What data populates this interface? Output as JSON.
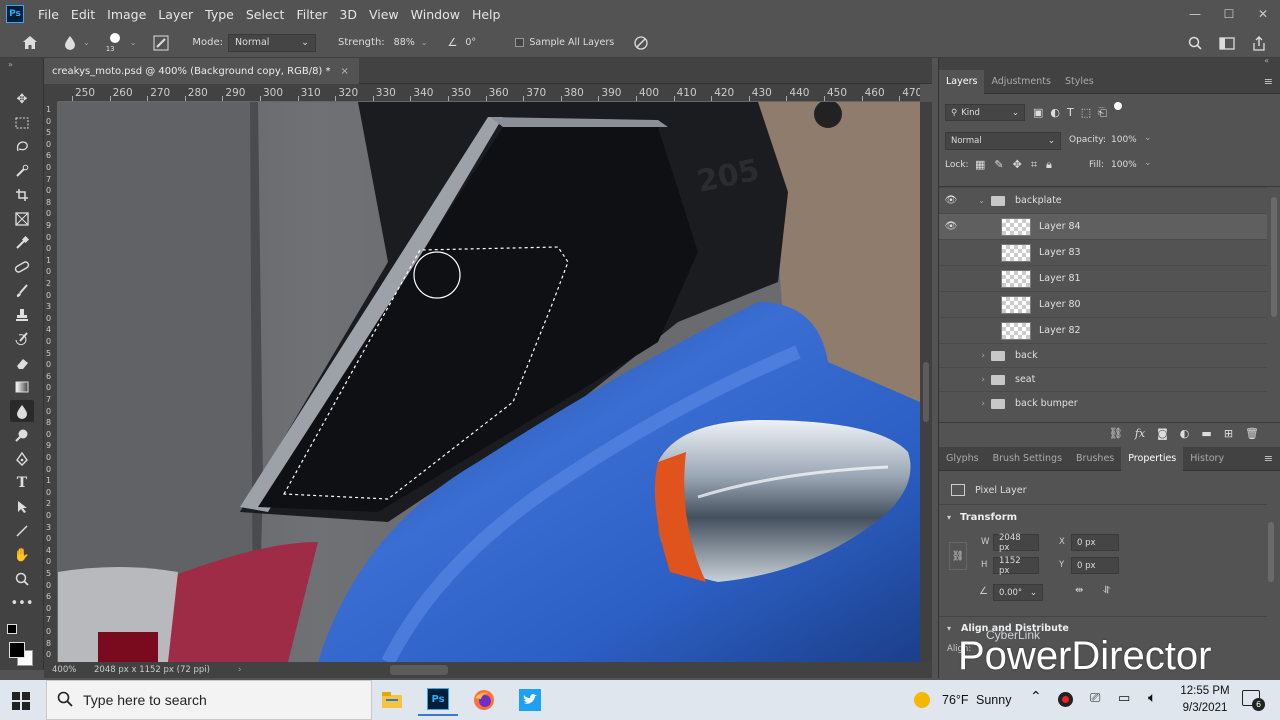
{
  "app": {
    "logo": "Ps",
    "window_controls": [
      "—",
      "☐",
      "✕"
    ]
  },
  "menu": [
    "File",
    "Edit",
    "Image",
    "Layer",
    "Type",
    "Select",
    "Filter",
    "3D",
    "View",
    "Window",
    "Help"
  ],
  "options": {
    "brush_size": "13",
    "mode_label": "Mode:",
    "mode_value": "Normal",
    "strength_label": "Strength:",
    "strength_value": "88%",
    "angle_value": "0°",
    "sample_label": "Sample All Layers"
  },
  "document": {
    "tab_title": "creakys_moto.psd @ 400% (Background copy, RGB/8) *",
    "close": "×"
  },
  "ruler_h": [
    "250",
    "260",
    "270",
    "280",
    "290",
    "300",
    "310",
    "320",
    "330",
    "340",
    "350",
    "360",
    "370",
    "380",
    "390",
    "400",
    "410",
    "420",
    "430",
    "440",
    "450",
    "460",
    "470"
  ],
  "ruler_v": [
    "1",
    "0",
    "5",
    "0",
    "6",
    "0",
    "7",
    "0",
    "8",
    "0",
    "9",
    "0",
    "0",
    "1",
    "0",
    "2",
    "0",
    "3",
    "0",
    "4",
    "0",
    "5",
    "0",
    "6",
    "0",
    "7",
    "0",
    "8",
    "0",
    "9",
    "0",
    "0",
    "1",
    "0",
    "2",
    "0",
    "3",
    "0",
    "4",
    "0",
    "5",
    "0",
    "6",
    "0",
    "7",
    "0",
    "8",
    "0"
  ],
  "canvas": {
    "plate_text": "205"
  },
  "status": {
    "zoom": "400%",
    "doc_info": "2048 px x 1152 px (72 ppi)",
    "arrow": "›"
  },
  "layers_panel": {
    "tabs": [
      "Layers",
      "Adjustments",
      "Styles"
    ],
    "kind_label": "Kind",
    "blend_mode": "Normal",
    "opacity_label": "Opacity:",
    "opacity_value": "100%",
    "lock_label": "Lock:",
    "fill_label": "Fill:",
    "fill_value": "100%",
    "layers": [
      {
        "name": "backplate",
        "type": "group",
        "visible": true,
        "expanded": true
      },
      {
        "name": "Layer 84",
        "type": "layer",
        "visible": true
      },
      {
        "name": "Layer 83",
        "type": "layer",
        "visible": false
      },
      {
        "name": "Layer 81",
        "type": "layer",
        "visible": false
      },
      {
        "name": "Layer 80",
        "type": "layer",
        "visible": false
      },
      {
        "name": "Layer 82",
        "type": "layer",
        "visible": false
      },
      {
        "name": "back",
        "type": "group",
        "visible": false
      },
      {
        "name": "seat",
        "type": "group",
        "visible": false
      },
      {
        "name": "back bumper",
        "type": "group",
        "visible": false
      }
    ]
  },
  "properties_panel": {
    "tabs": [
      "Glyphs",
      "Brush Settings",
      "Brushes",
      "Properties",
      "History"
    ],
    "kind": "Pixel Layer",
    "section": "Transform",
    "w_label": "W",
    "w_value": "2048 px",
    "h_label": "H",
    "h_value": "1152 px",
    "x_label": "X",
    "x_value": "0 px",
    "y_label": "Y",
    "y_value": "0 px",
    "angle_value": "0.00°",
    "align_section": "Align and Distribute",
    "align_sub": "Align:"
  },
  "watermark": {
    "top": "CyberLink",
    "main": "PowerDirector"
  },
  "taskbar": {
    "search_placeholder": "Type here to search",
    "weather_temp": "76°F",
    "weather_desc": "Sunny",
    "time": "12:55 PM",
    "date": "9/3/2021",
    "notif_count": "6"
  }
}
